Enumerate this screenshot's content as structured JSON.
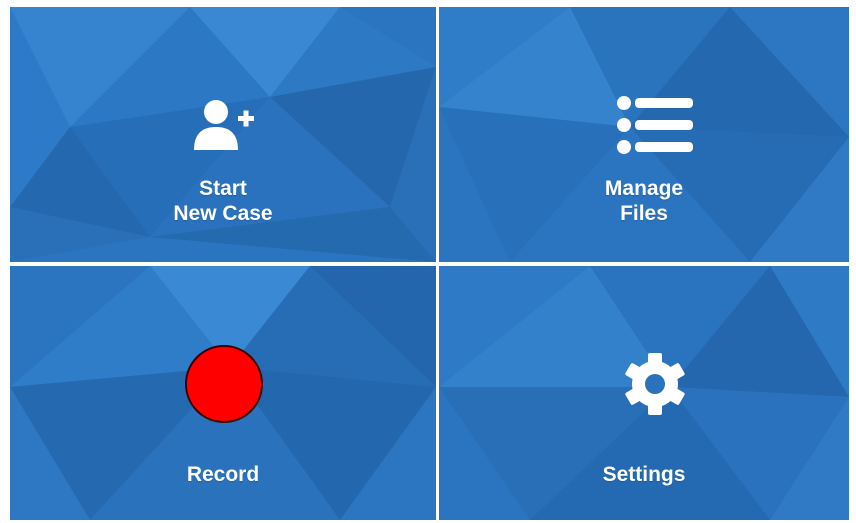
{
  "colors": {
    "background_blue": "#2a74c0",
    "divider": "#ffffff",
    "text": "#ffffff",
    "record_red": "#ff0000"
  },
  "tiles": [
    {
      "label": "Start\nNew Case",
      "icon": "add-user-icon"
    },
    {
      "label": "Manage\nFiles",
      "icon": "list-icon"
    },
    {
      "label": "Record",
      "icon": "record-icon"
    },
    {
      "label": "Settings",
      "icon": "gear-icon"
    }
  ]
}
